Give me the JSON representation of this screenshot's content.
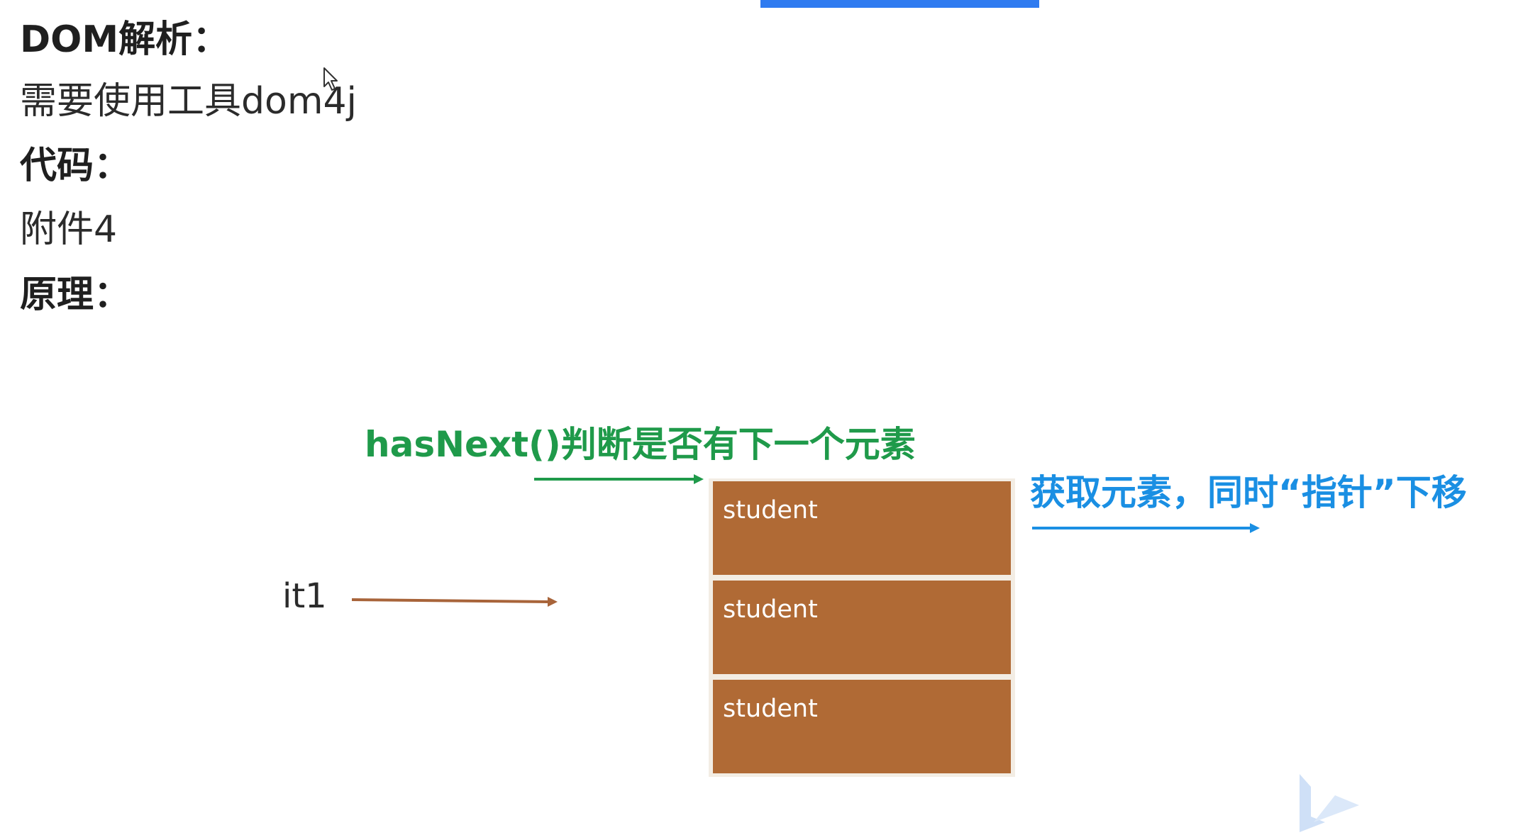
{
  "text": {
    "heading_dom": "DOM解析：",
    "line_tool": "需要使用工具dom4j",
    "heading_code": "代码：",
    "line_attachment": "附件4",
    "heading_principle": "原理："
  },
  "diagram": {
    "has_next_label": "hasNext()判断是否有下一个元素",
    "next_label": "获取元素，同时“指针”下移",
    "iterator_label": "it1",
    "stack_items": [
      {
        "label": "student"
      },
      {
        "label": "student"
      },
      {
        "label": "student"
      }
    ]
  },
  "colors": {
    "accent_bar": "#2f7bf0",
    "green": "#1f9a4a",
    "blue": "#1a8fe3",
    "brown_arrow": "#a8643a",
    "cell": "#b06a35"
  },
  "icons": {
    "cursor": "mouse-cursor-icon",
    "logo": "watermark-logo-icon"
  }
}
